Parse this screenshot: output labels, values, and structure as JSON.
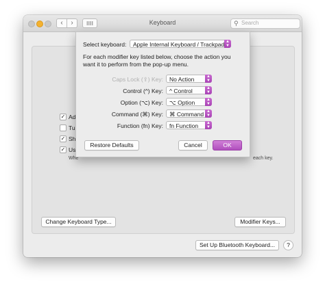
{
  "window": {
    "title": "Keyboard"
  },
  "search": {
    "placeholder": "Search"
  },
  "icons": {
    "back": "chevron-left-icon",
    "forward": "chevron-right-icon",
    "grid": "grid-icon",
    "search": "search-icon"
  },
  "colors": {
    "accent": "#b04fbd",
    "min_light": "#f4b230"
  },
  "background": {
    "checkboxes": [
      {
        "label": "Adj",
        "checked": true
      },
      {
        "label": "Tur",
        "checked": false
      },
      {
        "label": "Sho",
        "checked": true
      },
      {
        "label": "Use",
        "checked": true
      }
    ],
    "use_subtext_left": "Whe",
    "use_subtext_right": "each key.",
    "change_type_button": "Change Keyboard Type...",
    "modifier_keys_button": "Modifier Keys...",
    "bluetooth_button": "Set Up Bluetooth Keyboard...",
    "help": "?"
  },
  "sheet": {
    "select_label": "Select keyboard:",
    "selected_keyboard": "Apple Internal Keyboard / Trackpad",
    "description_line1": "For each modifier key listed below, choose the action you",
    "description_line2": "want it to perform from the pop-up menu.",
    "rows": [
      {
        "label": "Caps Lock (⇪) Key:",
        "value": "No Action",
        "dim": true
      },
      {
        "label": "Control (^) Key:",
        "value": "^ Control",
        "dim": false
      },
      {
        "label": "Option (⌥) Key:",
        "value": "⌥ Option",
        "dim": false
      },
      {
        "label": "Command (⌘) Key:",
        "value": "⌘ Command",
        "dim": false
      },
      {
        "label": "Function (fn) Key:",
        "value": "fn Function",
        "dim": false
      }
    ],
    "restore_button": "Restore Defaults",
    "cancel_button": "Cancel",
    "ok_button": "OK"
  }
}
